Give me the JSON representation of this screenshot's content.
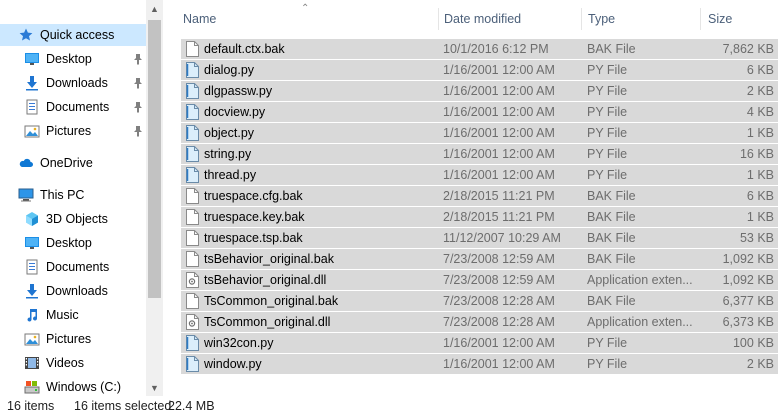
{
  "nav": {
    "items": [
      {
        "label": "Quick access",
        "icon": "star-icon",
        "pinned": false,
        "selected": true
      },
      {
        "label": "Desktop",
        "icon": "desktop-icon",
        "pinned": true
      },
      {
        "label": "Downloads",
        "icon": "download-icon",
        "pinned": true
      },
      {
        "label": "Documents",
        "icon": "documents-icon",
        "pinned": true
      },
      {
        "label": "Pictures",
        "icon": "pictures-icon",
        "pinned": true
      },
      {
        "label": "OneDrive",
        "icon": "cloud-icon",
        "pinned": false
      },
      {
        "label": "This PC",
        "icon": "computer-icon",
        "pinned": false
      },
      {
        "label": "3D Objects",
        "icon": "3d-objects-icon",
        "pinned": false
      },
      {
        "label": "Desktop",
        "icon": "desktop-icon",
        "pinned": false
      },
      {
        "label": "Documents",
        "icon": "documents-icon",
        "pinned": false
      },
      {
        "label": "Downloads",
        "icon": "download-icon",
        "pinned": false
      },
      {
        "label": "Music",
        "icon": "music-icon",
        "pinned": false
      },
      {
        "label": "Pictures",
        "icon": "pictures-icon",
        "pinned": false
      },
      {
        "label": "Videos",
        "icon": "videos-icon",
        "pinned": false
      },
      {
        "label": "Windows (C:)",
        "icon": "drive-icon",
        "pinned": false
      }
    ]
  },
  "columns": {
    "name": "Name",
    "date": "Date modified",
    "type": "Type",
    "size": "Size"
  },
  "files": [
    {
      "name": "default.ctx.bak",
      "date": "10/1/2016 6:12 PM",
      "type": "BAK File",
      "size": "7,862 KB",
      "icon": "generic-file-icon"
    },
    {
      "name": "dialog.py",
      "date": "1/16/2001 12:00 AM",
      "type": "PY File",
      "size": "6 KB",
      "icon": "python-file-icon"
    },
    {
      "name": "dlgpassw.py",
      "date": "1/16/2001 12:00 AM",
      "type": "PY File",
      "size": "2 KB",
      "icon": "python-file-icon"
    },
    {
      "name": "docview.py",
      "date": "1/16/2001 12:00 AM",
      "type": "PY File",
      "size": "4 KB",
      "icon": "python-file-icon"
    },
    {
      "name": "object.py",
      "date": "1/16/2001 12:00 AM",
      "type": "PY File",
      "size": "1 KB",
      "icon": "python-file-icon"
    },
    {
      "name": "string.py",
      "date": "1/16/2001 12:00 AM",
      "type": "PY File",
      "size": "16 KB",
      "icon": "python-file-icon"
    },
    {
      "name": "thread.py",
      "date": "1/16/2001 12:00 AM",
      "type": "PY File",
      "size": "1 KB",
      "icon": "python-file-icon"
    },
    {
      "name": "truespace.cfg.bak",
      "date": "2/18/2015 11:21 PM",
      "type": "BAK File",
      "size": "6 KB",
      "icon": "generic-file-icon"
    },
    {
      "name": "truespace.key.bak",
      "date": "2/18/2015 11:21 PM",
      "type": "BAK File",
      "size": "1 KB",
      "icon": "generic-file-icon"
    },
    {
      "name": "truespace.tsp.bak",
      "date": "11/12/2007 10:29 AM",
      "type": "BAK File",
      "size": "53 KB",
      "icon": "generic-file-icon"
    },
    {
      "name": "tsBehavior_original.bak",
      "date": "7/23/2008 12:59 AM",
      "type": "BAK File",
      "size": "1,092 KB",
      "icon": "generic-file-icon"
    },
    {
      "name": "tsBehavior_original.dll",
      "date": "7/23/2008 12:59 AM",
      "type": "Application exten...",
      "size": "1,092 KB",
      "icon": "dll-file-icon"
    },
    {
      "name": "TsCommon_original.bak",
      "date": "7/23/2008 12:28 AM",
      "type": "BAK File",
      "size": "6,377 KB",
      "icon": "generic-file-icon"
    },
    {
      "name": "TsCommon_original.dll",
      "date": "7/23/2008 12:28 AM",
      "type": "Application exten...",
      "size": "6,373 KB",
      "icon": "dll-file-icon"
    },
    {
      "name": "win32con.py",
      "date": "1/16/2001 12:00 AM",
      "type": "PY File",
      "size": "100 KB",
      "icon": "python-file-icon"
    },
    {
      "name": "window.py",
      "date": "1/16/2001 12:00 AM",
      "type": "PY File",
      "size": "2 KB",
      "icon": "python-file-icon"
    }
  ],
  "status": {
    "count": "16 items",
    "selected": "16 items selected",
    "size": "22.4 MB"
  },
  "colors": {
    "selection_bg": "#d9d9d9",
    "nav_selected_bg": "#cce8ff",
    "header_text": "#4c607a"
  }
}
